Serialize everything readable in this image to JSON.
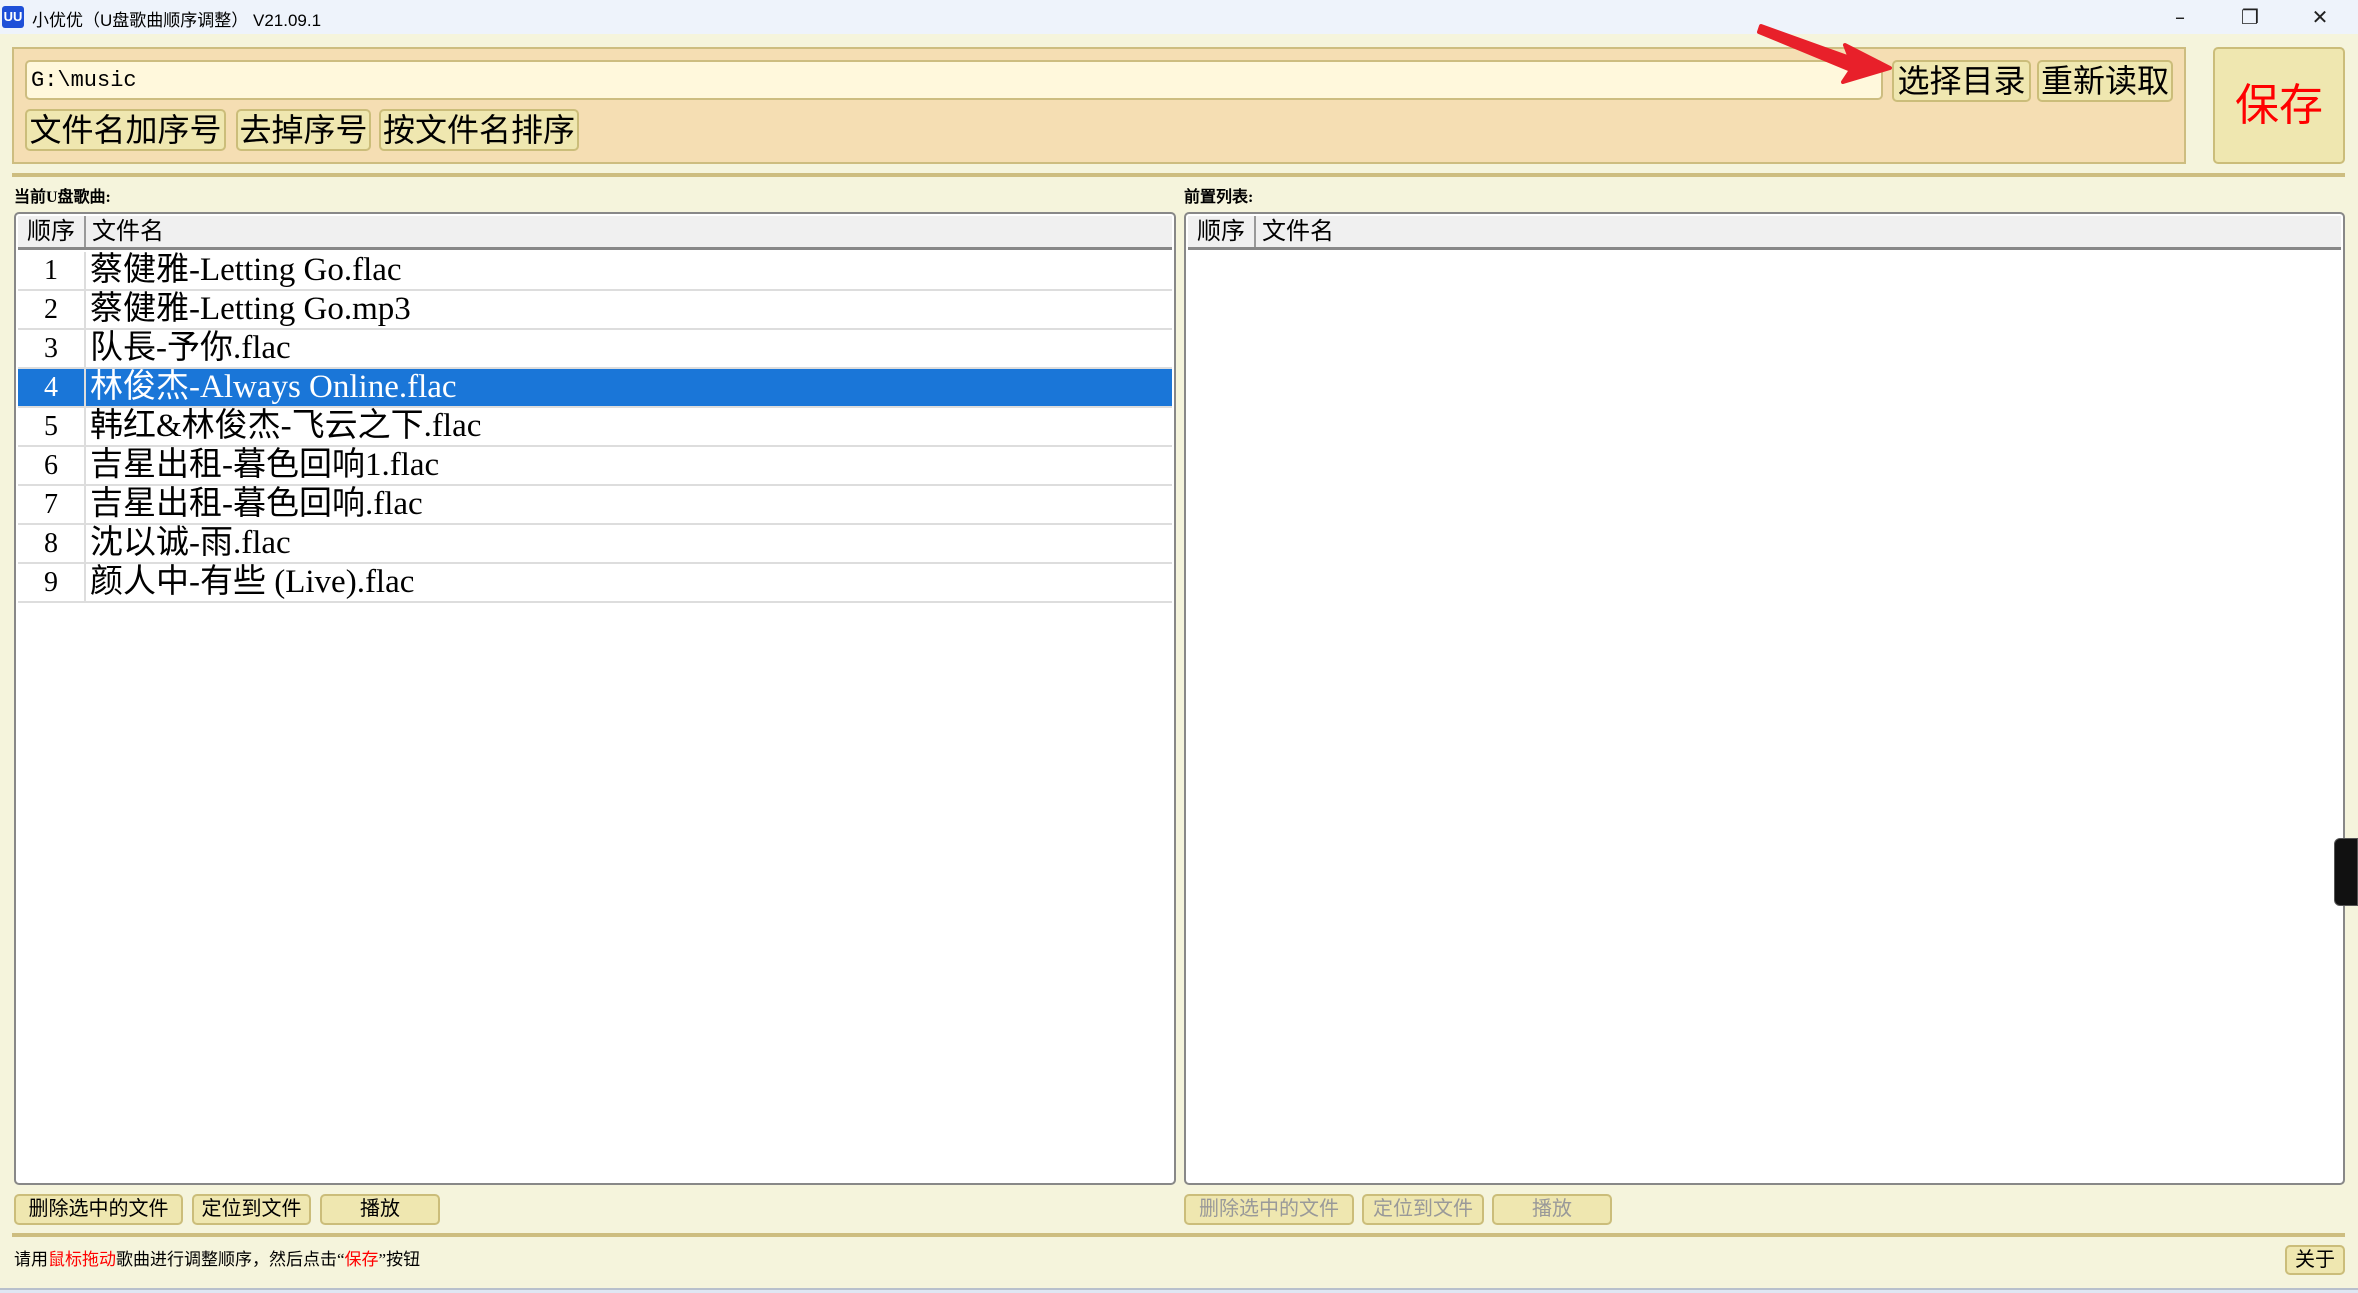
{
  "window": {
    "title": "小优优（U盘歌曲顺序调整） V21.09.1",
    "icon_text": "UU",
    "minimize": "–",
    "restore": "❐",
    "close": "✕"
  },
  "toolbar": {
    "path_value": "G:\\music",
    "add_index": "文件名加序号",
    "remove_index": "去掉序号",
    "sort_by_name": "按文件名排序",
    "choose_dir": "选择目录",
    "reload": "重新读取",
    "save": "保存"
  },
  "left": {
    "label": "当前U盘歌曲:",
    "col_order": "顺序",
    "col_name": "文件名",
    "rows": [
      {
        "n": "1",
        "name": "蔡健雅-Letting Go.flac"
      },
      {
        "n": "2",
        "name": "蔡健雅-Letting Go.mp3"
      },
      {
        "n": "3",
        "name": "队長-予你.flac"
      },
      {
        "n": "4",
        "name": "林俊杰-Always Online.flac",
        "selected": true
      },
      {
        "n": "5",
        "name": "韩红&林俊杰-飞云之下.flac"
      },
      {
        "n": "6",
        "name": "吉星出租-暮色回响1.flac"
      },
      {
        "n": "7",
        "name": "吉星出租-暮色回响.flac"
      },
      {
        "n": "8",
        "name": "沈以诚-雨.flac"
      },
      {
        "n": "9",
        "name": "颜人中-有些 (Live).flac"
      }
    ],
    "delete": "删除选中的文件",
    "locate": "定位到文件",
    "play": "播放"
  },
  "right": {
    "label": "前置列表:",
    "col_order": "顺序",
    "col_name": "文件名",
    "delete": "删除选中的文件",
    "locate": "定位到文件",
    "play": "播放"
  },
  "status": {
    "p1": "请用",
    "p2": "鼠标拖动",
    "p3": "歌曲进行调整顺序，然后点击“",
    "p4": "保存",
    "p5": "”按钮"
  },
  "about": "关于",
  "colors": {
    "selection": "#1a76d8",
    "panel": "#f5deb3",
    "button": "#efe7b0",
    "save_text": "#ff0000",
    "annotation_arrow": "#e8202a"
  }
}
